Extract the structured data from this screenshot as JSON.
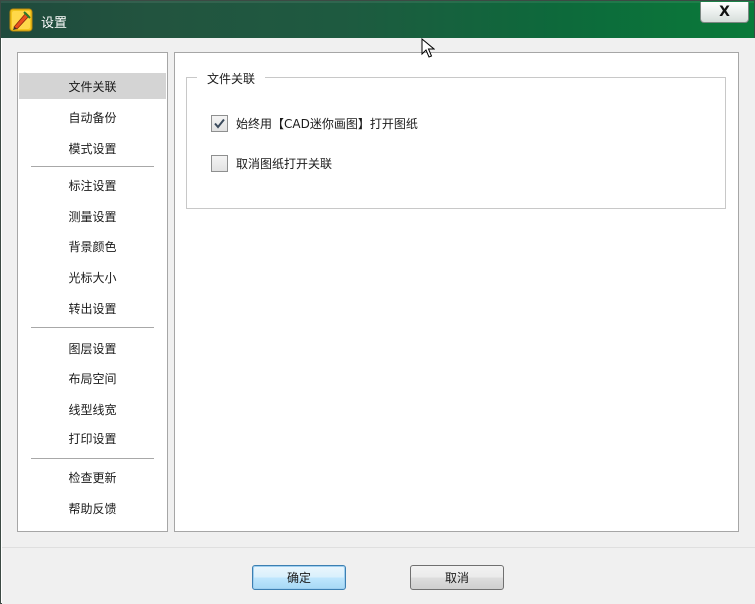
{
  "window": {
    "title": "设置",
    "close_label": "X"
  },
  "sidebar": {
    "items": [
      {
        "label": "文件关联",
        "selected": true
      },
      {
        "label": "自动备份",
        "selected": false
      },
      {
        "label": "模式设置",
        "selected": false
      },
      {
        "label": "标注设置",
        "selected": false
      },
      {
        "label": "测量设置",
        "selected": false
      },
      {
        "label": "背景颜色",
        "selected": false
      },
      {
        "label": "光标大小",
        "selected": false
      },
      {
        "label": "转出设置",
        "selected": false
      },
      {
        "label": "图层设置",
        "selected": false
      },
      {
        "label": "布局空间",
        "selected": false
      },
      {
        "label": "线型线宽",
        "selected": false
      },
      {
        "label": "打印设置",
        "selected": false
      },
      {
        "label": "检查更新",
        "selected": false
      },
      {
        "label": "帮助反馈",
        "selected": false
      }
    ]
  },
  "panel": {
    "group_title": "文件关联",
    "options": [
      {
        "label": "始终用【CAD迷你画图】打开图纸",
        "checked": true
      },
      {
        "label": "取消图纸打开关联",
        "checked": false
      }
    ]
  },
  "footer": {
    "ok_label": "确定",
    "cancel_label": "取消"
  },
  "colors": {
    "titlebar_start": "#1f4a3c",
    "titlebar_end": "#0a7a3a",
    "selected_item": "#d4d4d4",
    "primary_button_border": "#3c7fb1"
  }
}
